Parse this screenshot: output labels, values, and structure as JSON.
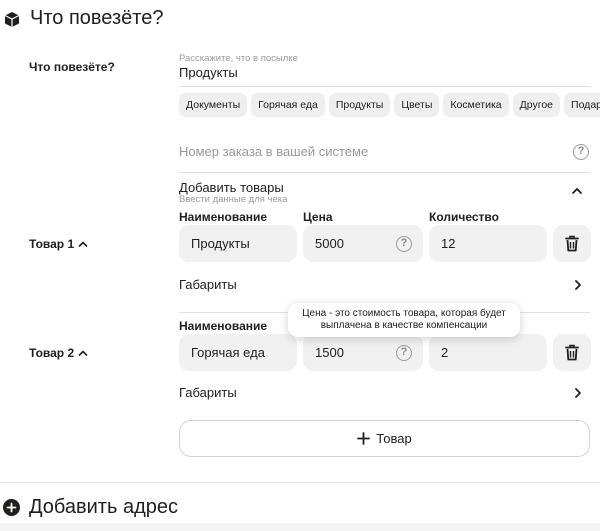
{
  "section": {
    "title": "Что повезёте?",
    "icon": "box-icon"
  },
  "cargo": {
    "label": "Что повезёте?",
    "hint": "Расскажите, что в посылке",
    "value": "Продукты",
    "chips": [
      "Документы",
      "Горячая еда",
      "Продукты",
      "Цветы",
      "Косметика",
      "Другое",
      "Подарок"
    ]
  },
  "order_number": {
    "placeholder": "Номер заказа в вашей системе"
  },
  "add_goods": {
    "title": "Добавить товары",
    "subtitle": "Ввести данные для чека"
  },
  "columns": {
    "name": "Наименование",
    "price": "Цена",
    "quantity": "Количество"
  },
  "items": [
    {
      "label": "Товар 1",
      "name": "Продукты",
      "price": "5000",
      "quantity": "12",
      "dimensions": "Габариты"
    },
    {
      "label": "Товар 2",
      "name": "Горячая еда",
      "price": "1500",
      "quantity": "2",
      "dimensions": "Габариты"
    }
  ],
  "tooltip": {
    "line1": "Цена - это стоимость товара, которая будет",
    "line2": "выплачена в качестве компенсации"
  },
  "add_item_button": {
    "label": "Товар"
  },
  "add_address": {
    "label": "Добавить адрес"
  },
  "colors": {
    "text": "#21201f",
    "field_bg": "#f1f1f1",
    "hint": "#9a9a9a"
  }
}
